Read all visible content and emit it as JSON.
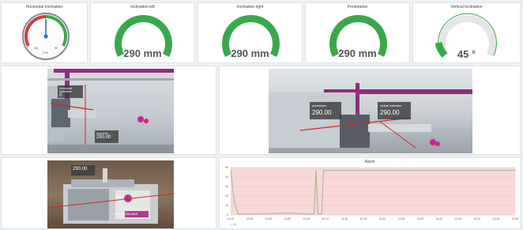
{
  "gauges": [
    {
      "title": "Horizontal Inclination",
      "scale_min": "-90",
      "scale_max": "90",
      "value": "0.00",
      "kind": "dial"
    },
    {
      "title": "Inclination left",
      "value": "290 mm",
      "kind": "arc",
      "fill": 1.0,
      "color": "#3aa84a"
    },
    {
      "title": "Inclination right",
      "value": "290 mm",
      "kind": "arc",
      "fill": 1.0,
      "color": "#3aa84a"
    },
    {
      "title": "Penetration",
      "value": "290 mm",
      "kind": "arc",
      "fill": 1.0,
      "color": "#3aa84a"
    },
    {
      "title": "Vertical Inclination",
      "value": "45 °",
      "kind": "arc",
      "fill": 0.08,
      "color": "#3aa84a"
    }
  ],
  "photo1": {
    "labels": [
      {
        "title": "Horizontal Inclination",
        "value": "0"
      },
      {
        "title": "Axis level",
        "value": "290.00"
      }
    ]
  },
  "photo2": {
    "labels": [
      {
        "title": "penetration",
        "value": "290.00"
      },
      {
        "title": "vertical inclination",
        "value": "290.00"
      }
    ]
  },
  "photo3": {
    "labels": [
      {
        "title": "",
        "value": "290.00"
      }
    ],
    "brand": "fives",
    "product": "Fives NOVAfLINER"
  },
  "chart": {
    "title": "Alarm",
    "legend": "— A",
    "y_ticks": [
      "50",
      "40",
      "30",
      "20",
      "10",
      "0"
    ],
    "x_ticks": [
      "13:20",
      "13:30",
      "13:40",
      "13:50",
      "14:00",
      "14:10",
      "14:20",
      "14:30",
      "14:40",
      "14:50",
      "15:00",
      "15:10",
      "15:20",
      "15:30",
      "15:40",
      "15:50"
    ],
    "line_color": "#9fb88a",
    "band_color": "#f8d8d8"
  },
  "chart_data": {
    "type": "line",
    "title": "Alarm",
    "ylim": [
      0,
      50
    ],
    "x_ticks": [
      "13:20",
      "13:30",
      "13:40",
      "13:50",
      "14:00",
      "14:10",
      "14:20",
      "14:30",
      "14:40",
      "14:50",
      "15:00",
      "15:10",
      "15:20",
      "15:30",
      "15:40",
      "15:50"
    ],
    "series": [
      {
        "name": "A",
        "x": [
          "13:20",
          "13:22",
          "13:24",
          "13:36",
          "13:50",
          "14:00",
          "14:02",
          "14:04",
          "14:05",
          "14:06",
          "14:07",
          "14:08",
          "14:09",
          "14:10",
          "15:50"
        ],
        "y": [
          47,
          12,
          1,
          1,
          2,
          1,
          1,
          1,
          47,
          1,
          1,
          1,
          47,
          47,
          47
        ]
      }
    ]
  }
}
